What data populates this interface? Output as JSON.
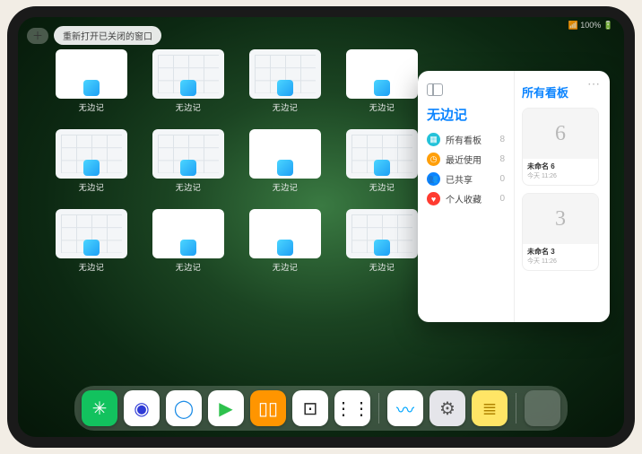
{
  "status": {
    "text": "📶 100% 🔋"
  },
  "topbar": {
    "plus_label": "＋",
    "reopen_label": "重新打开已关闭的窗口"
  },
  "windows": {
    "label": "无边记",
    "variants": [
      "blank",
      "grid",
      "grid",
      "blank",
      "grid",
      "grid",
      "blank",
      "grid",
      "grid",
      "blank",
      "blank",
      "grid"
    ]
  },
  "panel": {
    "left": {
      "title": "无边记",
      "items": [
        {
          "icon": "grid",
          "color": "#24c2d9",
          "label": "所有看板",
          "count": "8"
        },
        {
          "icon": "clock",
          "color": "#ff9f0a",
          "label": "最近使用",
          "count": "8"
        },
        {
          "icon": "people",
          "color": "#0b84ff",
          "label": "已共享",
          "count": "0"
        },
        {
          "icon": "heart",
          "color": "#ff3b30",
          "label": "个人收藏",
          "count": "0"
        }
      ]
    },
    "right": {
      "title": "所有看板",
      "cards": [
        {
          "glyph": "6",
          "name": "未命名 6",
          "time": "今天 11:26"
        },
        {
          "glyph": "3",
          "name": "未命名 3",
          "time": "今天 11:26"
        }
      ]
    }
  },
  "dock": {
    "apps": [
      {
        "name": "wechat",
        "bg": "#12c25e",
        "glyph": "✳",
        "fg": "#fff"
      },
      {
        "name": "quark",
        "bg": "#ffffff",
        "glyph": "◉",
        "fg": "#2f3bd6"
      },
      {
        "name": "qqbrowser",
        "bg": "#ffffff",
        "glyph": "◯",
        "fg": "#1e8de6"
      },
      {
        "name": "video",
        "bg": "#ffffff",
        "glyph": "▶",
        "fg": "#2ec14d"
      },
      {
        "name": "books",
        "bg": "#ff9500",
        "glyph": "▯▯",
        "fg": "#fff"
      },
      {
        "name": "dice",
        "bg": "#ffffff",
        "glyph": "⊡",
        "fg": "#222"
      },
      {
        "name": "ai-app",
        "bg": "#ffffff",
        "glyph": "⋮⋮",
        "fg": "#222"
      }
    ],
    "recents": [
      {
        "name": "freeform",
        "bg": "#ffffff",
        "glyph": "〰",
        "fg": "#00a6ff"
      },
      {
        "name": "settings",
        "bg": "#e5e5ea",
        "glyph": "⚙",
        "fg": "#555"
      },
      {
        "name": "notes",
        "bg": "#ffe566",
        "glyph": "≣",
        "fg": "#b08400"
      }
    ],
    "appLibrary": {
      "tiles": [
        "#ff3b30",
        "#34c759",
        "#ff9500",
        "#0b84ff"
      ]
    }
  }
}
